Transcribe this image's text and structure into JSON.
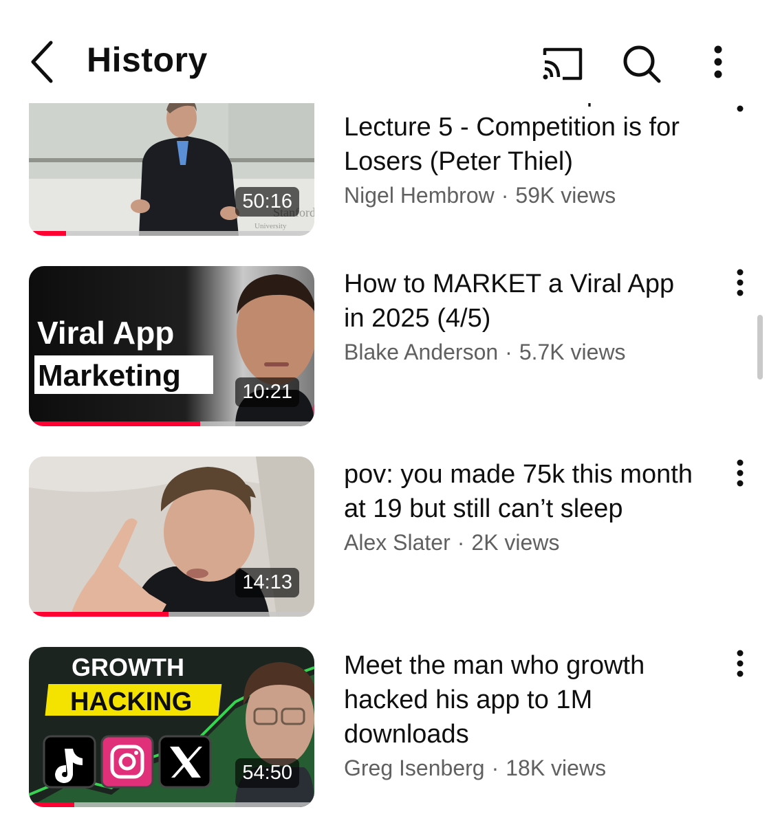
{
  "header": {
    "title": "History",
    "icons": [
      "back-icon",
      "cast-icon",
      "search-icon",
      "more-vert-icon"
    ]
  },
  "videos": [
    {
      "title_partial": "How to Start a Startup:",
      "title": "Lecture 5 - Competition is for Losers (Peter Thiel)",
      "channel": "Nigel Hembrow",
      "views": "59K views",
      "duration": "50:16",
      "thumb_text": [
        "Stanford",
        "University"
      ],
      "progress": 0.13
    },
    {
      "title": "How to MARKET a Viral App in 2025 (4/5)",
      "channel": "Blake Anderson",
      "views": "5.7K views",
      "duration": "10:21",
      "thumb_text": [
        "Viral App",
        "Marketing"
      ],
      "progress": 0.6
    },
    {
      "title": "pov: you made 75k this month at 19 but still can’t sleep",
      "channel": "Alex Slater",
      "views": "2K views",
      "duration": "14:13",
      "thumb_text": [],
      "progress": 0.49
    },
    {
      "title": "Meet the man who growth hacked his app to 1M downloads",
      "channel": "Greg Isenberg",
      "views": "18K views",
      "duration": "54:50",
      "thumb_text": [
        "GROWTH",
        "HACKING"
      ],
      "progress": 0.16
    }
  ],
  "separator": "·",
  "colors": {
    "accent": "#ff0033",
    "text_primary": "#0f0f0f",
    "text_secondary": "#606060"
  }
}
